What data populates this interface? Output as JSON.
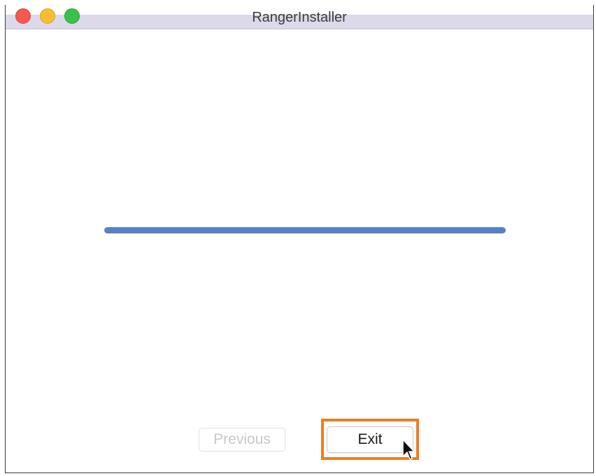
{
  "window": {
    "title": "RangerInstaller"
  },
  "progress": {
    "value": 1.0
  },
  "buttons": {
    "previous_label": "Previous",
    "exit_label": "Exit"
  },
  "colors": {
    "progress_fill": "#5a7fc7",
    "highlight": "#ee7d22",
    "titlebar": "#dcd9ea"
  },
  "icons": {
    "close": "close-icon",
    "minimize": "minimize-icon",
    "zoom": "zoom-icon",
    "cursor": "pointer-cursor-icon"
  }
}
